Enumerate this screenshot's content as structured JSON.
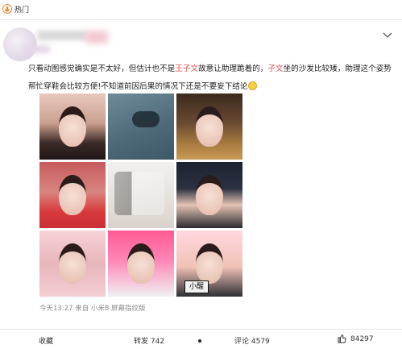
{
  "header": {
    "hot_label": "热门",
    "hot_icon": "fire-icon"
  },
  "post": {
    "text_parts": [
      "只看动图感觉确实是不太好，但估计也不是",
      "王子文",
      "故意让助理跪着的，",
      "子文",
      "坐的沙发比较矮，助理这个姿势帮忙穿鞋会比较方便!不知道前因后果的情况下还是不要妄下结论"
    ],
    "accent_color": "#e84f4f",
    "emoji_icon": "sweat-smile-emoji-icon"
  },
  "photos": [
    {
      "name": "photo-1"
    },
    {
      "name": "photo-2"
    },
    {
      "name": "photo-3"
    },
    {
      "name": "photo-4"
    },
    {
      "name": "photo-5"
    },
    {
      "name": "photo-6"
    },
    {
      "name": "photo-7"
    },
    {
      "name": "photo-8"
    },
    {
      "name": "photo-9",
      "tag_text": "小醒"
    }
  ],
  "meta": {
    "line": "今天13:27  来自 小米8 屏幕指纹版"
  },
  "actions": {
    "favorite_label": "收藏",
    "repost_label": "转发 742",
    "comment_label": "评论 4579",
    "like_count": "84297",
    "like_icon": "thumbs-up-icon"
  }
}
